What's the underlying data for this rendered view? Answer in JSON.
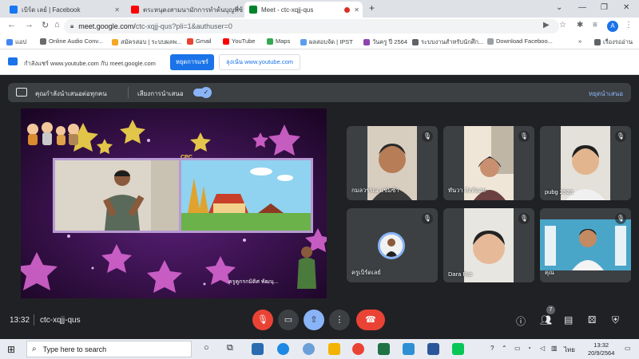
{
  "browser": {
    "tabs": [
      {
        "title": "เบิร์ด เลย์ | Facebook",
        "icon": "facebook-icon",
        "color": "#1877f2",
        "active": false
      },
      {
        "title": "ตระหนุดงสามนามักการทำต้นบุญที่ซ้...",
        "icon": "youtube-icon",
        "color": "#ff0000",
        "active": false
      },
      {
        "title": "Meet - ctc-xqjj-qus",
        "icon": "meet-icon",
        "color": "#00832d",
        "active": true
      }
    ],
    "new_tab": "+",
    "url": "meet.google.com/",
    "url_path": "ctc-xqjj-qus?pli=1&authuser=0",
    "profile_initial": "A"
  },
  "bookmarks": [
    {
      "label": "แอป",
      "color": "#4285f4"
    },
    {
      "label": "Online Audio Conv...",
      "color": "#6a6a6a"
    },
    {
      "label": "สมัครสอบ | ระบบผลพ...",
      "color": "#f6a623"
    },
    {
      "label": "Gmail",
      "color": "#ea4335"
    },
    {
      "label": "YouTube",
      "color": "#ff0000"
    },
    {
      "label": "Maps",
      "color": "#34a853"
    },
    {
      "label": "ผลสอบจัด | IPST",
      "color": "#5c9ded"
    },
    {
      "label": "วันครู ปี 2564",
      "color": "#8e44ad"
    },
    {
      "label": "ระบบงานสำหรับนักศึก...",
      "color": "#5f6368"
    },
    {
      "label": "Download Faceboo...",
      "color": "#9aa0a6"
    }
  ],
  "bookmarks_more": "»",
  "reading_list": "เรื่องรออ่าน",
  "infobar": {
    "message": "กำลังแชร์ www.youtube.com กับ meet.google.com",
    "stop_label": "หยุดการแชร์",
    "switch_label": "ลุงเน้น www.youtube.com"
  },
  "presenting_bar": {
    "status": "คุณกำลังนำเสนอต่อทุกคน",
    "audio_label": "เสียงการนำเสนอ",
    "stop_label": "หยุดนำเสนอ"
  },
  "presentation": {
    "caption": "ครูคูกรกมิติศ   พัฒนุ...",
    "logo": "CPC"
  },
  "participants": [
    {
      "name": "กมลวรรณ แซ่มซ้า",
      "muted": true
    },
    {
      "name": "ทันวา สังห์ออย",
      "muted": true
    },
    {
      "name": "pubg 2523",
      "muted": true
    },
    {
      "name": "ครูเบิร์ดเลย์",
      "muted": true
    },
    {
      "name": "Dara Rat",
      "muted": true
    },
    {
      "name": "คุณ",
      "muted": true
    }
  ],
  "meeting": {
    "time": "13:32",
    "separator": "|",
    "code": "ctc-xqjj-qus",
    "people_count": "7"
  },
  "taskbar": {
    "search_placeholder": "Type here to search",
    "lang": "ไทย",
    "time": "13:32",
    "date": "20/9/2564"
  }
}
